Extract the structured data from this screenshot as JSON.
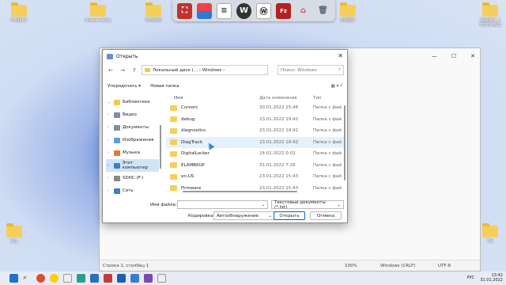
{
  "desktop": {
    "icons": [
      "ЯНДЕКС",
      "Новая папка",
      "РАЗНОЕ",
      "ВИДЕО",
      "YASHMA_1 TUTORIALS",
      "ALL",
      "Tip"
    ]
  },
  "launcher": {
    "icons": [
      "app-red-icon",
      "app-red-blue-icon",
      "document-icon",
      "w-icon",
      "wiki-icon",
      "filezilla-icon",
      "home-icon",
      "recycle-icon"
    ],
    "labels": {
      "doc": "W",
      "filezilla": "Fz"
    }
  },
  "notepad": {
    "status": {
      "pos": "Строка 1, столбец 1",
      "zoom": "100%",
      "eol": "Windows (CRLF)",
      "enc": "UTF-8"
    },
    "controls": {
      "min": "—",
      "max": "☐",
      "close": "✕"
    }
  },
  "dialog": {
    "title": "Открыть",
    "close": "✕",
    "nav": {
      "back": "←",
      "forward": "→",
      "up": "↑"
    },
    "address": "Локальный диск (... › Windows ›",
    "search_placeholder": "Поиск: Windows",
    "toolbar": {
      "organize": "Упорядочить ▾",
      "new_folder": "Новая папка"
    },
    "tree": [
      {
        "label": "Библиотеки",
        "color": "#f2c94c"
      },
      {
        "label": "Видео",
        "color": "#7a8ea8"
      },
      {
        "label": "Документы",
        "color": "#7a8ea8"
      },
      {
        "label": "Изображения",
        "color": "#5aa0d8"
      },
      {
        "label": "Музыка",
        "color": "#e07b39"
      },
      {
        "label": "Этот компьютер",
        "color": "#3b7fc4"
      },
      {
        "label": "SDHC (F:)",
        "color": "#888888"
      },
      {
        "label": "Сеть",
        "color": "#3b7fc4"
      }
    ],
    "columns": {
      "name": "Имя",
      "date": "Дата изменения",
      "type": "Тип"
    },
    "files": [
      {
        "name": "Cursors",
        "date": "30.01.2022 15:46",
        "type": "Папка с фай"
      },
      {
        "name": "debug",
        "date": "23.01.2022 19:42",
        "type": "Папка с фай"
      },
      {
        "name": "diagnostics",
        "date": "23.01.2022 19:42",
        "type": "Папка с фай"
      },
      {
        "name": "DiagTrack",
        "date": "23.01.2022 19:42",
        "type": "Папка с фай"
      },
      {
        "name": "DigitalLocker",
        "date": "24.01.2022 0:02",
        "type": "Папка с фай"
      },
      {
        "name": "ELAMBKUP",
        "date": "31.01.2022 7:29",
        "type": "Папка с фай"
      },
      {
        "name": "en-US",
        "date": "23.01.2022 15:43",
        "type": "Папка с фай"
      },
      {
        "name": "Firmware",
        "date": "23.01.2022 15:43",
        "type": "Папка с фай"
      }
    ],
    "filename_label": "Имя файла:",
    "filename_value": "",
    "filetype": "Текстовые документы (*.txt)",
    "encoding_label": "Кодировка:",
    "encoding_value": "Автообнаружение",
    "open": "Открыть",
    "cancel": "Отмена"
  },
  "tray": {
    "lang": "РУС",
    "time": "13:42",
    "date": "31.01.2022"
  }
}
